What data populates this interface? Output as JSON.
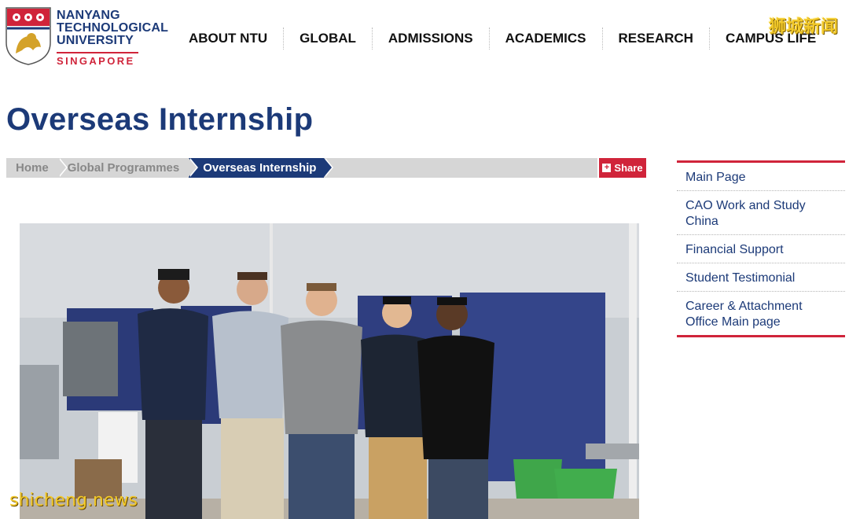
{
  "logo": {
    "line1": "NANYANG",
    "line2": "TECHNOLOGICAL",
    "line3": "UNIVERSITY",
    "line4": "SINGAPORE"
  },
  "topnav": [
    "ABOUT NTU",
    "GLOBAL",
    "ADMISSIONS",
    "ACADEMICS",
    "RESEARCH",
    "CAMPUS LIFE"
  ],
  "watermark_top": "狮城新闻",
  "page_title": "Overseas Internship",
  "breadcrumb": [
    "Home",
    "Global Programmes",
    "Overseas Internship"
  ],
  "share_label": "Share",
  "sidebar": [
    "Main Page",
    "CAO Work and Study China",
    "Financial Support",
    "Student Testimonial",
    "Career & Attachment Office Main page"
  ],
  "watermark_bottom": "shicheng.news",
  "colors": {
    "brand_blue": "#1c3a78",
    "brand_red": "#d0243a",
    "breadcrumb_bg": "#d6d6d6"
  },
  "icons": {
    "share": "plus-square-icon",
    "logo": "ntu-crest-icon"
  }
}
